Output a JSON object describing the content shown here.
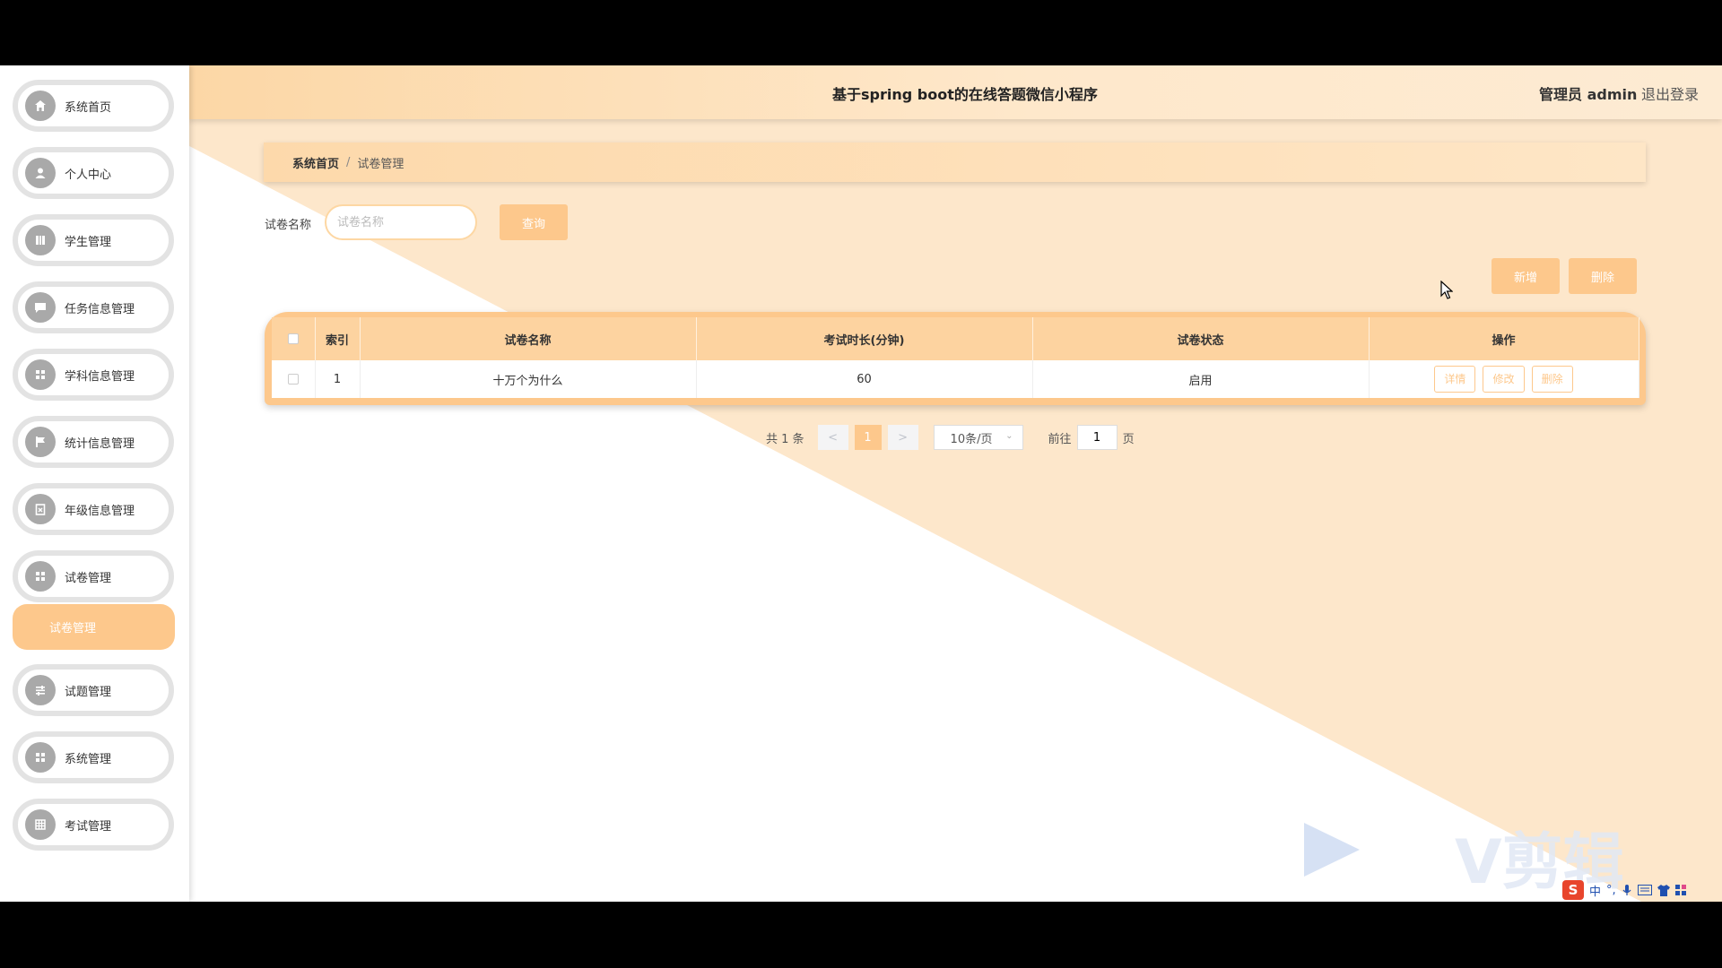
{
  "header": {
    "title": "基于spring boot的在线答题微信小程序",
    "user_label": "管理员 admin",
    "logout_label": "退出登录"
  },
  "sidebar": {
    "items": [
      {
        "label": "系统首页",
        "icon": "home-icon"
      },
      {
        "label": "个人中心",
        "icon": "user-icon"
      },
      {
        "label": "学生管理",
        "icon": "book-icon"
      },
      {
        "label": "任务信息管理",
        "icon": "chat-icon"
      },
      {
        "label": "学科信息管理",
        "icon": "grid-icon"
      },
      {
        "label": "统计信息管理",
        "icon": "flag-icon"
      },
      {
        "label": "年级信息管理",
        "icon": "clipboard-icon"
      },
      {
        "label": "试卷管理",
        "icon": "grid-icon"
      },
      {
        "label": "试题管理",
        "icon": "sliders-icon"
      },
      {
        "label": "系统管理",
        "icon": "grid-icon"
      },
      {
        "label": "考试管理",
        "icon": "table-icon"
      }
    ],
    "active_submenu": "试卷管理"
  },
  "breadcrumb": {
    "home": "系统首页",
    "separator": "/",
    "current": "试卷管理"
  },
  "search": {
    "label": "试卷名称",
    "placeholder": "试卷名称",
    "value": "",
    "button_label": "查询"
  },
  "actions": {
    "add_label": "新增",
    "delete_label": "删除"
  },
  "table": {
    "columns": [
      "索引",
      "试卷名称",
      "考试时长(分钟)",
      "试卷状态",
      "操作"
    ],
    "rows": [
      {
        "index": "1",
        "name": "十万个为什么",
        "duration": "60",
        "status": "启用"
      }
    ],
    "row_actions": [
      "详情",
      "修改",
      "删除"
    ]
  },
  "pagination": {
    "total_text": "共 1 条",
    "prev": "<",
    "current_page": "1",
    "next": ">",
    "page_size": "10条/页",
    "goto_prefix": "前往",
    "goto_value": "1",
    "goto_suffix": "页"
  },
  "watermark": {
    "text": "V剪辑"
  },
  "ime": {
    "logo": "S",
    "mode": "中"
  },
  "colors": {
    "accent": "#fdc88c",
    "header_start": "#fcd7a6",
    "header_end": "#fdebd3",
    "bg_band": "#fde6c8"
  }
}
